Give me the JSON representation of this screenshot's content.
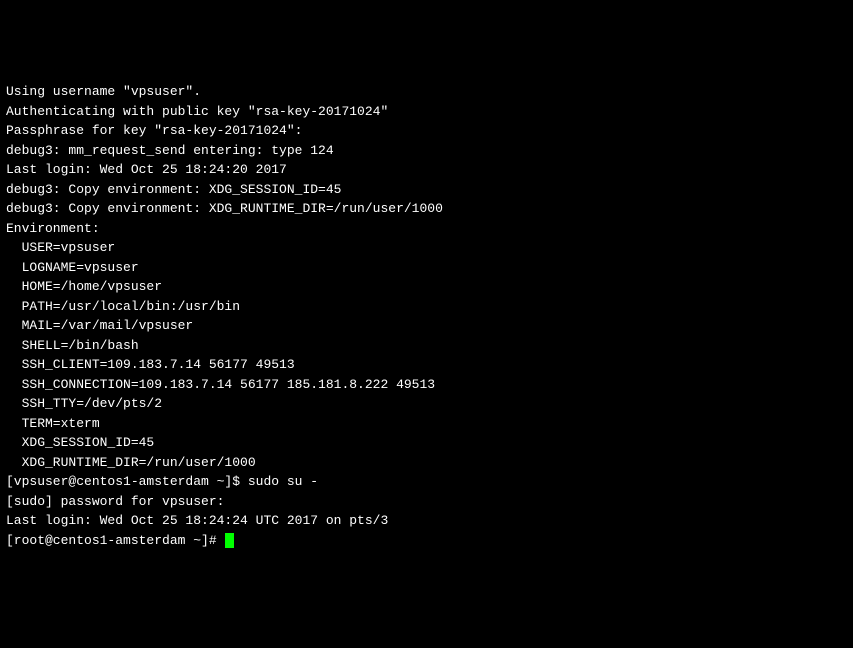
{
  "lines": {
    "l0": "Using username \"vpsuser\".",
    "l1": "Authenticating with public key \"rsa-key-20171024\"",
    "l2": "Passphrase for key \"rsa-key-20171024\":",
    "l3": "debug3: mm_request_send entering: type 124",
    "l4": "Last login: Wed Oct 25 18:24:20 2017",
    "l5": "debug3: Copy environment: XDG_SESSION_ID=45",
    "l6": "debug3: Copy environment: XDG_RUNTIME_DIR=/run/user/1000",
    "l7": "Environment:",
    "l8": "  USER=vpsuser",
    "l9": "  LOGNAME=vpsuser",
    "l10": "  HOME=/home/vpsuser",
    "l11": "  PATH=/usr/local/bin:/usr/bin",
    "l12": "  MAIL=/var/mail/vpsuser",
    "l13": "  SHELL=/bin/bash",
    "l14": "  SSH_CLIENT=109.183.7.14 56177 49513",
    "l15": "  SSH_CONNECTION=109.183.7.14 56177 185.181.8.222 49513",
    "l16": "  SSH_TTY=/dev/pts/2",
    "l17": "  TERM=xterm",
    "l18": "  XDG_SESSION_ID=45",
    "l19": "  XDG_RUNTIME_DIR=/run/user/1000",
    "l20": "[vpsuser@centos1-amsterdam ~]$ sudo su -",
    "l21": "[sudo] password for vpsuser:",
    "l22": "Last login: Wed Oct 25 18:24:24 UTC 2017 on pts/3",
    "l23": "[root@centos1-amsterdam ~]# "
  }
}
